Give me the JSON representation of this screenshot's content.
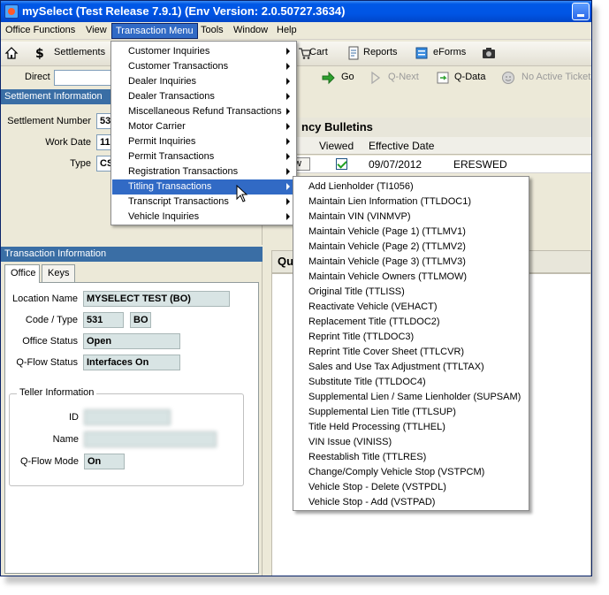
{
  "window": {
    "title": "mySelect (Test Release 7.9.1) (Env Version: 2.0.50727.3634)"
  },
  "menubar": [
    "Office Functions",
    "View",
    "Transaction Menu",
    "Tools",
    "Window",
    "Help"
  ],
  "toolbar": {
    "settlements": "Settlements",
    "cart": "Cart",
    "reports": "Reports",
    "eforms": "eForms",
    "direct_label": "Direct",
    "go": "Go",
    "qnext": "Q-Next",
    "qdata": "Q-Data",
    "active_ticket": "No Active Ticket"
  },
  "settlement": {
    "header": "Settlement Information",
    "number_label": "Settlement Number",
    "number_value": "53",
    "workdate_label": "Work Date",
    "workdate_value": "11",
    "type_label": "Type",
    "type_value": "CS"
  },
  "transaction_info": {
    "header": "Transaction Information",
    "tabs": [
      "Office",
      "Keys"
    ],
    "location_label": "Location Name",
    "location_value": "MYSELECT TEST (BO)",
    "code_label": "Code / Type",
    "code_value": "531",
    "type_value": "BO",
    "office_status_label": "Office Status",
    "office_status_value": "Open",
    "qflow_status_label": "Q-Flow Status",
    "qflow_status_value": "Interfaces On",
    "teller_group": "Teller Information",
    "id_label": "ID",
    "name_label": "Name",
    "qflow_mode_label": "Q-Flow Mode",
    "qflow_mode_value": "On"
  },
  "bulletins": {
    "title": "ncy Bulletins",
    "col_viewed": "Viewed",
    "col_effective": "Effective Date",
    "row_button": "w",
    "row_date": "09/07/2012",
    "row_user": "ERESWED",
    "q_title": "Qu"
  },
  "transaction_menu": [
    "Customer Inquiries",
    "Customer Transactions",
    "Dealer Inquiries",
    "Dealer Transactions",
    "Miscellaneous Refund Transactions",
    "Motor Carrier",
    "Permit Inquiries",
    "Permit Transactions",
    "Registration Transactions",
    "Titling Transactions",
    "Transcript Transactions",
    "Vehicle Inquiries"
  ],
  "titling_submenu": [
    "Add Lienholder (TI1056)",
    "Maintain Lien Information (TTLDOC1)",
    "Maintain VIN (VINMVP)",
    "Maintain Vehicle (Page 1) (TTLMV1)",
    "Maintain Vehicle (Page 2) (TTLMV2)",
    "Maintain Vehicle (Page 3) (TTLMV3)",
    "Maintain Vehicle Owners (TTLMOW)",
    "Original Title (TTLISS)",
    "Reactivate Vehicle (VEHACT)",
    "Replacement Title (TTLDOC2)",
    "Reprint Title (TTLDOC3)",
    "Reprint Title Cover Sheet (TTLCVR)",
    "Sales and Use Tax Adjustment (TTLTAX)",
    "Substitute Title (TTLDOC4)",
    "Supplemental Lien / Same Lienholder (SUPSAM)",
    "Supplemental Lien Title (TTLSUP)",
    "Title Held Processing (TTLHEL)",
    "VIN Issue (VINISS)",
    "Reestablish Title (TTLRES)",
    "Change/Comply Vehicle Stop (VSTPCM)",
    "Vehicle Stop - Delete (VSTPDL)",
    "Vehicle Stop - Add (VSTPAD)"
  ],
  "colors": {
    "titlebar": "#0055e5",
    "highlight": "#316ac5",
    "section_header": "#3a6ea5",
    "readonly_field": "#d8e4e4"
  }
}
